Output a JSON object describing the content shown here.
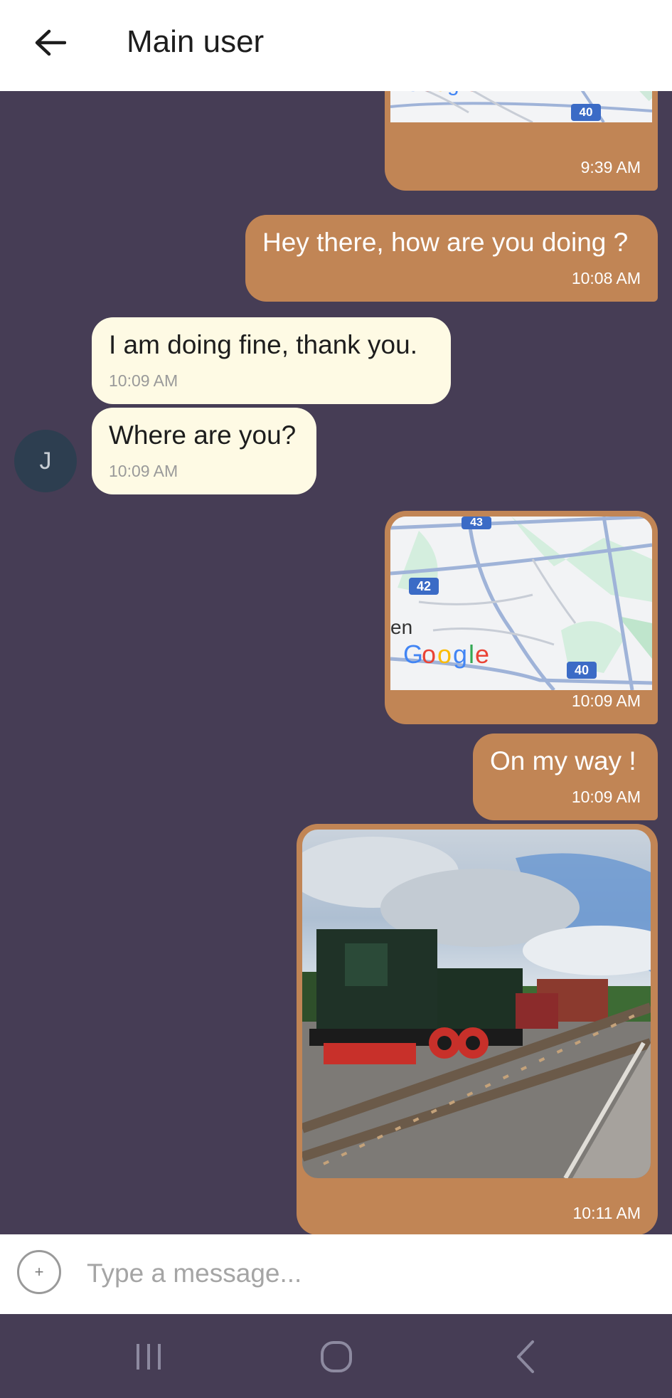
{
  "header": {
    "title": "Main user",
    "back_icon": "arrow-left-icon"
  },
  "avatar": {
    "initial": "J"
  },
  "messages": [
    {
      "side": "out",
      "type": "location",
      "time": "9:39 AM",
      "map": {
        "route_badge": "40",
        "logo": "Google"
      }
    },
    {
      "side": "out",
      "type": "text",
      "text": "Hey there, how are you doing ?",
      "time": "10:08 AM"
    },
    {
      "side": "in",
      "type": "text",
      "text": "I am doing fine, thank you.",
      "time": "10:09 AM"
    },
    {
      "side": "in",
      "type": "text",
      "text": "Where are you?",
      "time": "10:09 AM"
    },
    {
      "side": "out",
      "type": "location",
      "time": "10:09 AM",
      "map": {
        "badges": [
          "43",
          "42",
          "40"
        ],
        "place_fragment": "en",
        "logo": "Google"
      }
    },
    {
      "side": "out",
      "type": "text",
      "text": "On my way !",
      "time": "10:09 AM"
    },
    {
      "side": "out",
      "type": "image",
      "time": "10:11 AM"
    }
  ],
  "composer": {
    "placeholder": "Type a message...",
    "attach_icon": "plus-circle-icon"
  },
  "system_nav": {
    "icons": [
      "recent-apps-icon",
      "home-icon",
      "back-icon"
    ]
  },
  "colors": {
    "chat_background": "#463d55",
    "outgoing_bubble": "#c18555",
    "incoming_bubble": "#fefae4",
    "avatar": "#2d3e50",
    "header": "#ffffff"
  }
}
